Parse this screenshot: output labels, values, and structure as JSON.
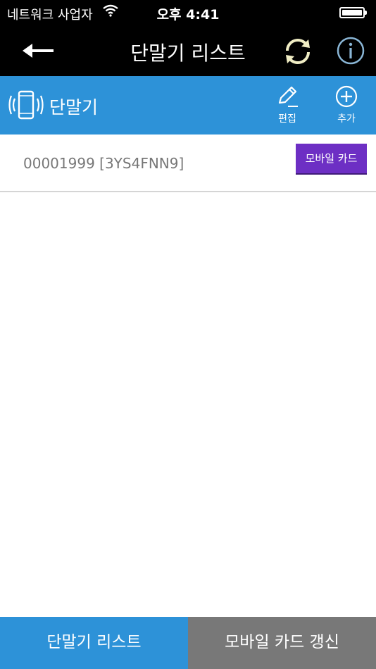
{
  "status_bar": {
    "carrier": "네트워크 사업자",
    "time": "오후 4:41"
  },
  "nav": {
    "title": "단말기 리스트",
    "back_icon": "back-arrow-icon",
    "refresh_icon": "refresh-icon",
    "info_icon": "info-icon"
  },
  "toolbar": {
    "label": "단말기",
    "edit_label": "편집",
    "add_label": "추가",
    "color": "#2d92d8"
  },
  "devices": [
    {
      "name": "00001999 [3YS4FNN9]",
      "button_label": "모바일 카드"
    }
  ],
  "tabs": {
    "device_list": "단말기 리스트",
    "mobile_card_renew": "모바일 카드 갱신",
    "active_color": "#2d92d8",
    "inactive_color": "#787878"
  },
  "button_color": "#6d2fc4"
}
